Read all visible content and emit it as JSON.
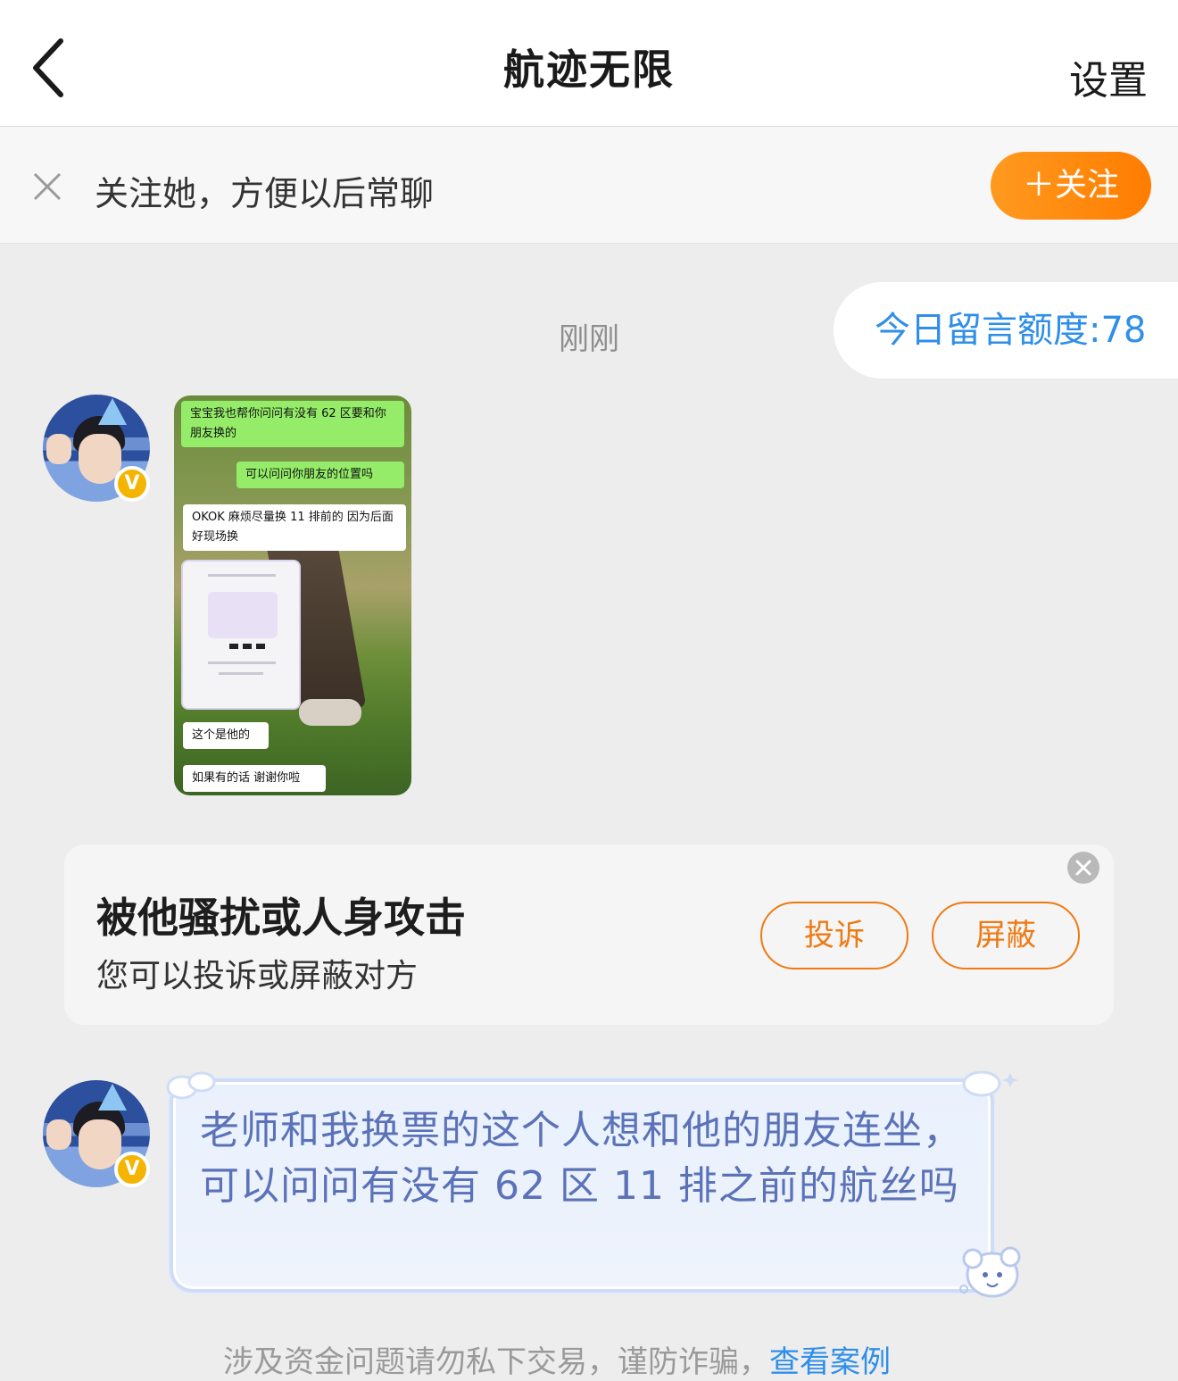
{
  "header": {
    "title": "航迹无限",
    "settings_label": "设置"
  },
  "follow_bar": {
    "text": "关注她，方便以后常聊",
    "button_label": "＋关注"
  },
  "chat": {
    "timestamp": "刚刚",
    "quota_label": "今日留言额度:78",
    "image_message": {
      "bubbles": [
        "宝宝我也帮你问问有没有 62 区要和你朋友换的",
        "可以问问你朋友的位置吗",
        "OKOK 麻烦尽量换 11 排前的 因为后面好现场换",
        "这个是他的",
        "如果有的话 谢谢你啦"
      ]
    },
    "text_message": "老师和我换票的这个人想和他的朋友连坐，可以问问有没有 62 区 11 排之前的航丝吗"
  },
  "safety_card": {
    "title": "被他骚扰或人身攻击",
    "subtitle": "您可以投诉或屏蔽对方",
    "report_label": "投诉",
    "block_label": "屏蔽"
  },
  "bottom_notice": {
    "text": "涉及资金问题请勿私下交易，谨防诈骗，",
    "link": "查看案例"
  },
  "colors": {
    "accent_orange": "#ff8a0d",
    "link_blue": "#2f8fe8",
    "message_text": "#5b72b8",
    "verified_badge": "#f5b400"
  }
}
